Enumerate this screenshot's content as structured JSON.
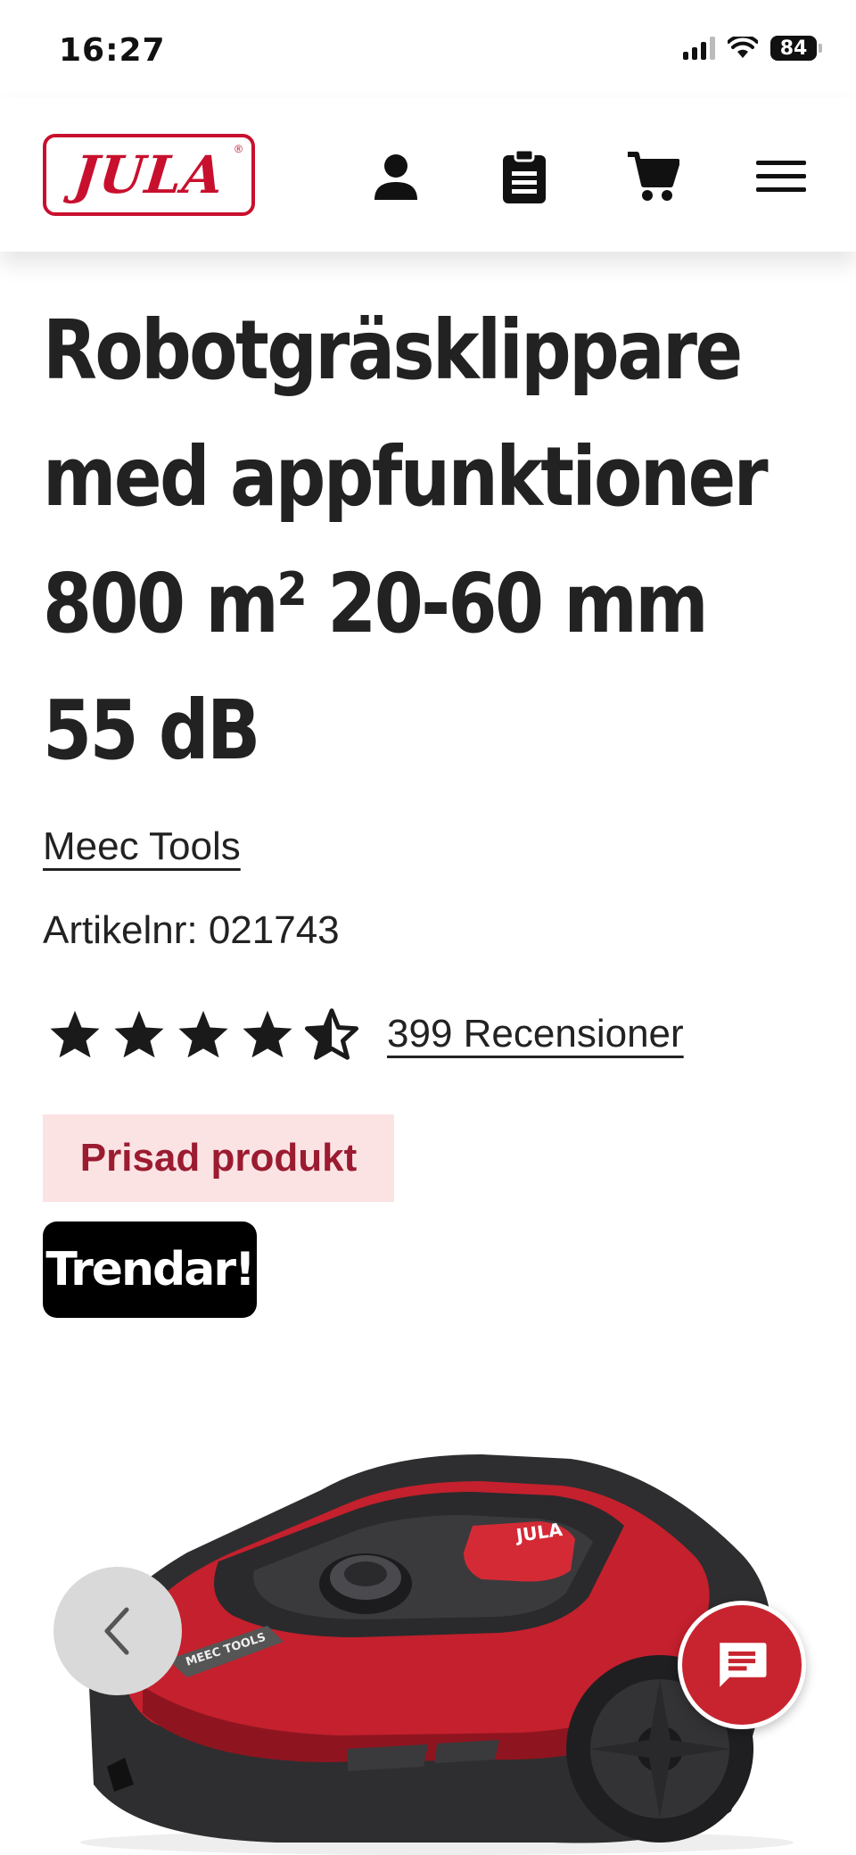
{
  "status_bar": {
    "time": "16:27",
    "battery": "84"
  },
  "header": {
    "logo_text": "JULA",
    "icons": [
      "account-icon",
      "shopping-list-icon",
      "cart-icon",
      "menu-icon"
    ]
  },
  "product": {
    "title": "Robotgräsklippare med appfunktioner 800 m² 20-60 mm 55 dB",
    "brand": "Meec Tools",
    "article_number": "Artikelnr: 021743",
    "rating": 4.5,
    "rating_max": 5,
    "reviews_label": "399 Recensioner",
    "badges": {
      "award": "Prisad produkt",
      "trend": "Trendar!"
    },
    "image_brand_text": "MEEC TOOLS",
    "image_cover_text": "JULA"
  },
  "colors": {
    "brand_red": "#c8102e",
    "award_badge_bg": "#fbe3e4",
    "award_badge_text": "#9b1b30",
    "chat_button": "#c8242f"
  }
}
